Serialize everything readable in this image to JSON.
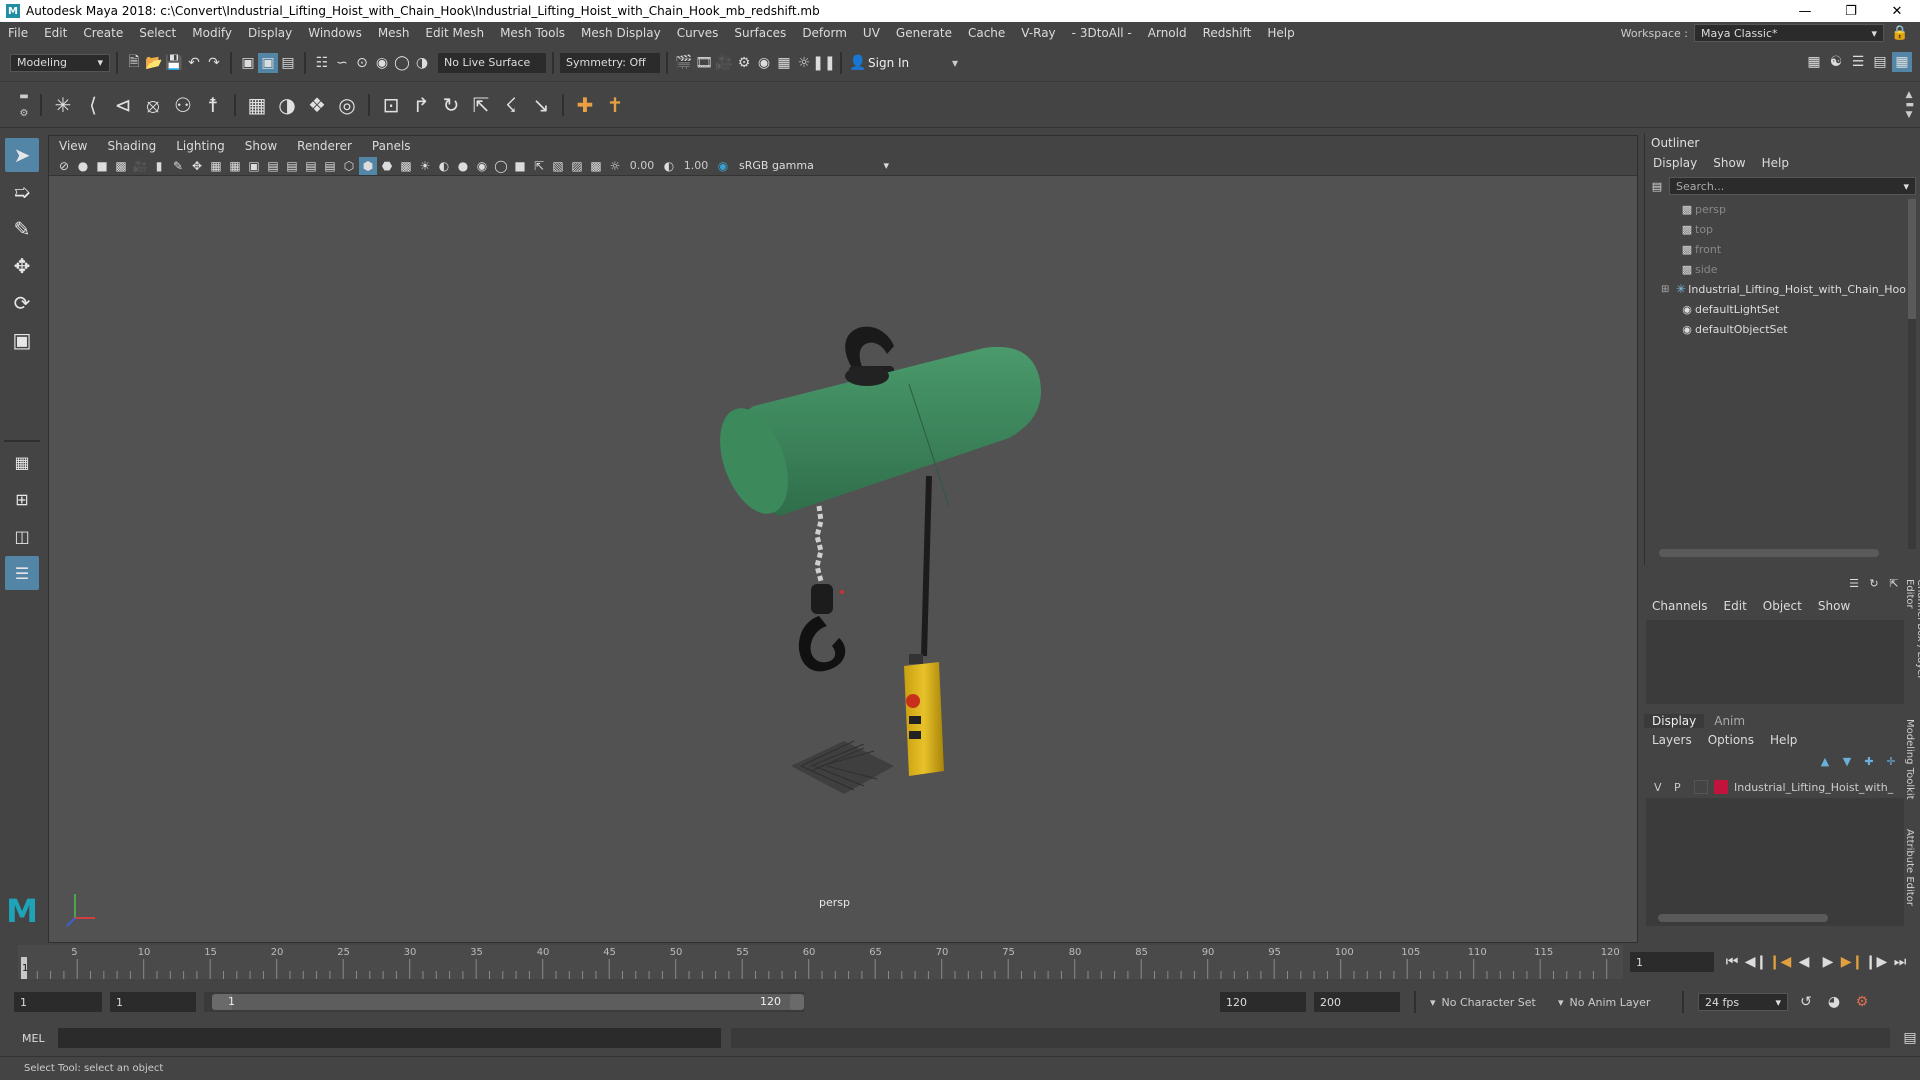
{
  "app": {
    "title": "Autodesk Maya 2018: c:\\Convert\\Industrial_Lifting_Hoist_with_Chain_Hook\\Industrial_Lifting_Hoist_with_Chain_Hook_mb_redshift.mb",
    "logo_letter": "M"
  },
  "menubar": {
    "items": [
      "File",
      "Edit",
      "Create",
      "Select",
      "Modify",
      "Display",
      "Windows",
      "Mesh",
      "Edit Mesh",
      "Mesh Tools",
      "Mesh Display",
      "Curves",
      "Surfaces",
      "Deform",
      "UV",
      "Generate",
      "Cache",
      "V-Ray",
      "- 3DtoAll -",
      "Arnold",
      "Redshift",
      "Help"
    ],
    "workspace_label": "Workspace :",
    "workspace_value": "Maya Classic*"
  },
  "statusline": {
    "mode": "Modeling",
    "live_surface": "No Live Surface",
    "symmetry": "Symmetry: Off",
    "sign_in": "Sign In"
  },
  "viewport": {
    "menu": [
      "View",
      "Shading",
      "Lighting",
      "Show",
      "Renderer",
      "Panels"
    ],
    "gamma_value1": "0.00",
    "gamma_value2": "1.00",
    "color_space": "sRGB gamma",
    "camera_label": "persp"
  },
  "outliner": {
    "title": "Outliner",
    "menu": [
      "Display",
      "Show",
      "Help"
    ],
    "search_placeholder": "Search...",
    "items": [
      {
        "label": "persp",
        "dim": true
      },
      {
        "label": "top",
        "dim": true
      },
      {
        "label": "front",
        "dim": true
      },
      {
        "label": "side",
        "dim": true
      },
      {
        "label": "Industrial_Lifting_Hoist_with_Chain_Hoo",
        "dim": false
      },
      {
        "label": "defaultLightSet",
        "dim": false
      },
      {
        "label": "defaultObjectSet",
        "dim": false
      }
    ]
  },
  "channelbox": {
    "menu": [
      "Channels",
      "Edit",
      "Object",
      "Show"
    ]
  },
  "layereditor": {
    "tabs": [
      "Display",
      "Anim"
    ],
    "menu": [
      "Layers",
      "Options",
      "Help"
    ],
    "layer": {
      "v": "V",
      "p": "P",
      "name": "Industrial_Lifting_Hoist_with_C",
      "color": "#c0143c"
    }
  },
  "sidetabs": [
    "Channel Box / Layer Editor",
    "Modeling Toolkit",
    "Attribute Editor"
  ],
  "timeslider": {
    "ticks": [
      "5",
      "10",
      "15",
      "20",
      "25",
      "30",
      "35",
      "40",
      "45",
      "50",
      "55",
      "60",
      "65",
      "70",
      "75",
      "80",
      "85",
      "90",
      "95",
      "100",
      "105",
      "110",
      "115",
      "120"
    ],
    "current_frame": "1",
    "frame_field": "1"
  },
  "rangeslider": {
    "start": "1",
    "start2": "1",
    "range_start_label": "1",
    "range_end_label": "120",
    "end": "120",
    "end2": "200",
    "character_set": "No Character Set",
    "anim_layer": "No Anim Layer",
    "fps": "24 fps"
  },
  "cmdline": {
    "label": "MEL"
  },
  "helpline": {
    "text": "Select Tool: select an object"
  },
  "colors": {
    "hoist_body": "#3f8a5f",
    "pendant": "#d8b21a",
    "active_tool": "#5285a6"
  }
}
